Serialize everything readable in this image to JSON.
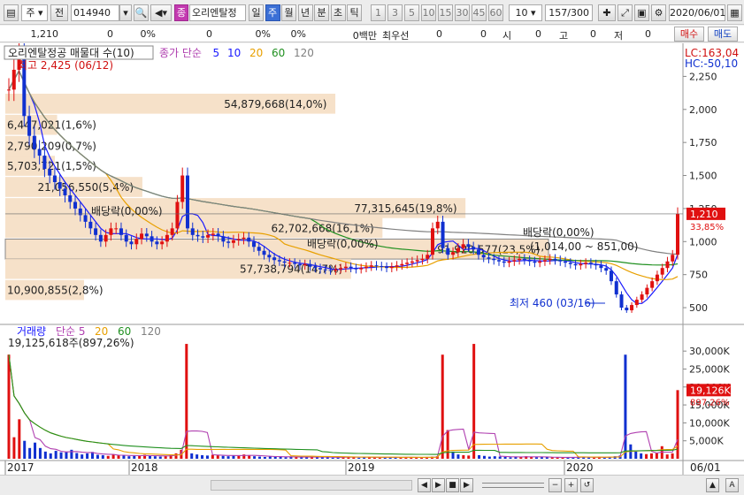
{
  "toolbar": {
    "market_type": "주",
    "prev_label": "전",
    "stock_code": "014940",
    "stock_name": "오리엔탈정",
    "badge": "종",
    "periods": [
      "일",
      "주",
      "월",
      "년",
      "분",
      "초",
      "틱"
    ],
    "active_period": "주",
    "intervals": [
      "1",
      "3",
      "5",
      "10",
      "15",
      "30",
      "45",
      "60"
    ],
    "interval_value": "10",
    "page_counter": "157/300",
    "date": "2020/06/01"
  },
  "infobar": {
    "price": "1,210",
    "change": "0",
    "change_pct": "0%",
    "volume": "0",
    "volume_pct": "0%",
    "amount_pct": "0%",
    "amount_label": "0백만",
    "priority_label": "최우선",
    "bid": "0",
    "ask": "0",
    "open_label": "시",
    "open": "0",
    "high_label": "고",
    "high": "0",
    "low_label": "저",
    "low": "0",
    "buy_label": "매수",
    "sell_label": "매도"
  },
  "chart": {
    "price_title": "오리엔탈정공 매물대 수(10)",
    "price_legend": [
      {
        "name": "종가 단순",
        "color": "#b040b0"
      },
      {
        "name": "5",
        "color": "#1a1aff"
      },
      {
        "name": "10",
        "color": "#1a1aff"
      },
      {
        "name": "20",
        "color": "#e8a000"
      },
      {
        "name": "60",
        "color": "#209020"
      },
      {
        "name": "120",
        "color": "#808080"
      }
    ],
    "lc_label": "LC:163,04",
    "hc_label": "HC:-50,10",
    "high_annot": "최고 2,425 (06/12)",
    "low_annot": "최저 460 (03/16)",
    "current_price_tag": "1,210",
    "current_pct_tag": "33,85%",
    "dividend_label": "배당락(0,00%)",
    "range_label": "(1,014,00 ~ 851,00)",
    "volume_profile": [
      {
        "label": "54,879,668(14,0%)",
        "price": 2040,
        "pct": 14.0
      },
      {
        "label": "6,447,021(1,6%)",
        "price": 1880,
        "pct": 1.6
      },
      {
        "label": "2,790,209(0,7%)",
        "price": 1720,
        "pct": 0.7
      },
      {
        "label": "5,703,721(1,5%)",
        "price": 1570,
        "pct": 1.5
      },
      {
        "label": "21,056,550(5,4%)",
        "price": 1410,
        "pct": 5.4
      },
      {
        "label": "77,315,645(19,8%)",
        "price": 1250,
        "pct": 19.8
      },
      {
        "label": "62,702,668(16,1%)",
        "price": 1100,
        "pct": 16.1
      },
      {
        "label": "91,920,577(23,5%)",
        "price": 940,
        "pct": 23.5
      },
      {
        "label": "57,738,794(14,7%)",
        "price": 790,
        "pct": 14.7
      },
      {
        "label": "10,900,855(2,8%)",
        "price": 630,
        "pct": 2.8
      }
    ],
    "price_axis": {
      "ticks": [
        "2,250",
        "2,000",
        "1,750",
        "1,500",
        "1,250",
        "1,000",
        "750",
        "500"
      ],
      "min": 400,
      "max": 2420
    },
    "volume_title": "거래량",
    "volume_legend": [
      {
        "name": "단순 5",
        "color": "#b040b0"
      },
      {
        "name": "20",
        "color": "#e8a000"
      },
      {
        "name": "60",
        "color": "#209020"
      },
      {
        "name": "120",
        "color": "#808080"
      }
    ],
    "volume_info": "19,125,618주(897,26%)",
    "volume_axis": {
      "ticks": [
        "30,000K",
        "25,000K",
        "20,000K",
        "15,000K",
        "10,000K",
        "5,000K"
      ],
      "max": 33000
    },
    "volume_tag": "19,126K",
    "volume_pct_tag": "897,26%",
    "x_labels": [
      "2017",
      "2018",
      "2019",
      "2020"
    ],
    "x_last_label": "06/01",
    "price_series": [
      2150,
      2300,
      2425,
      1950,
      1800,
      1700,
      1650,
      1550,
      1500,
      1450,
      1400,
      1350,
      1300,
      1250,
      1200,
      1150,
      1100,
      1050,
      1000,
      1050,
      1100,
      1100,
      1050,
      1000,
      980,
      1020,
      1060,
      1040,
      1000,
      980,
      1000,
      1050,
      1100,
      1300,
      1500,
      1100,
      1050,
      1040,
      1030,
      1050,
      1060,
      1040,
      1000,
      990,
      1010,
      1020,
      1030,
      1000,
      960,
      930,
      900,
      880,
      860,
      850,
      840,
      840,
      830,
      820,
      830,
      810,
      800,
      790,
      785,
      780,
      790,
      800,
      810,
      800,
      790,
      800,
      810,
      820,
      815,
      810,
      800,
      810,
      820,
      830,
      840,
      850,
      860,
      870,
      900,
      1100,
      1150,
      950,
      900,
      920,
      950,
      980,
      960,
      940,
      900,
      880,
      870,
      860,
      850,
      840,
      850,
      860,
      870,
      860,
      850,
      840,
      850,
      860,
      870,
      860,
      850,
      840,
      830,
      820,
      830,
      840,
      830,
      820,
      800,
      780,
      700,
      600,
      500,
      480,
      520,
      560,
      600,
      650,
      700,
      750,
      800,
      850,
      900,
      1210
    ],
    "volume_series": [
      29000,
      6000,
      11000,
      5000,
      3000,
      4500,
      3000,
      2000,
      1500,
      2200,
      1800,
      2000,
      2500,
      1600,
      1200,
      1500,
      1900,
      1100,
      1000,
      800,
      1200,
      1000,
      900,
      700,
      800,
      900,
      1100,
      800,
      700,
      600,
      800,
      1200,
      1500,
      2500,
      32000,
      1500,
      1200,
      1000,
      900,
      1100,
      1000,
      800,
      700,
      900,
      1000,
      1200,
      900,
      700,
      600,
      500,
      700,
      600,
      500,
      400,
      600,
      500,
      400,
      500,
      600,
      400,
      500,
      400,
      300,
      400,
      500,
      600,
      400,
      300,
      400,
      500,
      400,
      350,
      300,
      400,
      500,
      450,
      400,
      350,
      300,
      400,
      500,
      600,
      700,
      29000,
      8000,
      2000,
      1200,
      1000,
      900,
      32000,
      1000,
      800,
      600,
      700,
      600,
      500,
      400,
      500,
      600,
      700,
      500,
      400,
      450,
      500,
      400,
      350,
      300,
      400,
      500,
      600,
      400,
      350,
      300,
      400,
      500,
      600,
      700,
      900,
      29000,
      4000,
      2000,
      1500,
      1300,
      1500,
      1700,
      3500,
      1200,
      1500,
      19126
    ]
  },
  "bottombar": {
    "buttons": [
      "◀",
      "▶",
      "■",
      "▶",
      "−",
      "+",
      "↺",
      "▲",
      "A"
    ]
  }
}
